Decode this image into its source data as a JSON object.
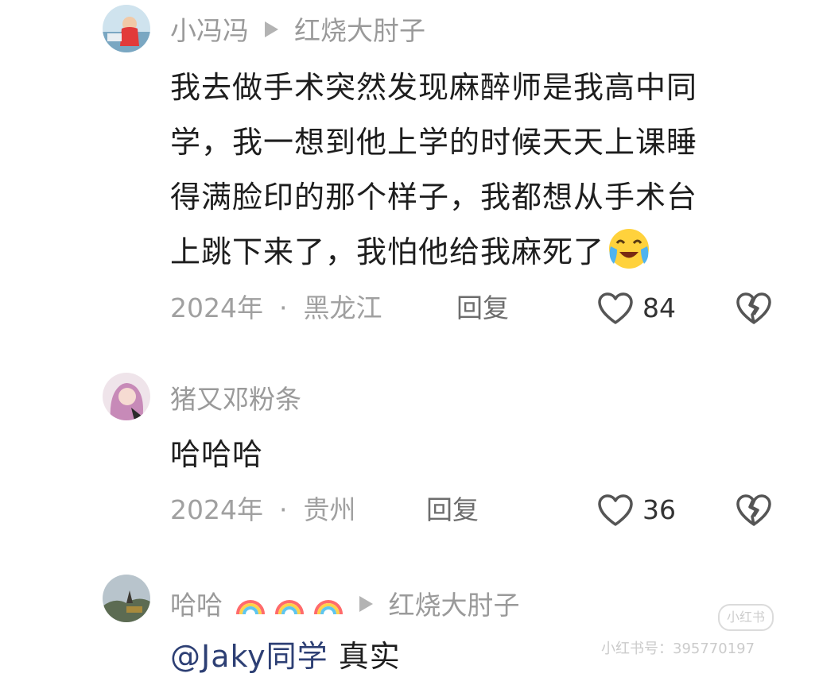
{
  "comments": [
    {
      "username": "小冯冯",
      "reply_to": "红烧大肘子",
      "text": "我去做手术突然发现麻醉师是我高中同学，我一想到他上学的时候天天上课睡得满脸印的那个样子，我都想从手术台上跳下来了，我怕他给我麻死了",
      "lines": [
        "我去做手术突然发现麻醉师是我高中同",
        "学，我一想到他上学的时候天天上课睡",
        "得满脸印的那个样子，我都想从手术台",
        "上跳下来了，我怕他给我麻死了"
      ],
      "emoji": "crying-laughing-emoji",
      "date": "2024年",
      "separator": "·",
      "location": "黑龙江",
      "reply_label": "回复",
      "likes": "84"
    },
    {
      "username": "猪又邓粉条",
      "text": "哈哈哈",
      "date": "2024年",
      "separator": "·",
      "location": "贵州",
      "reply_label": "回复",
      "likes": "36"
    },
    {
      "username": "哈哈",
      "username_emojis": [
        "rainbow-emoji",
        "rainbow-emoji",
        "rainbow-emoji"
      ],
      "reply_to": "红烧大肘子",
      "mention": "@Jaky同学",
      "text": "真实"
    }
  ],
  "watermark": {
    "brand": "小红书",
    "id_text": "小红书号：395770197"
  },
  "colors": {
    "meta_gray": "#9a9a9a",
    "text": "#1e1e1e",
    "mention_blue": "#2d3f74"
  }
}
